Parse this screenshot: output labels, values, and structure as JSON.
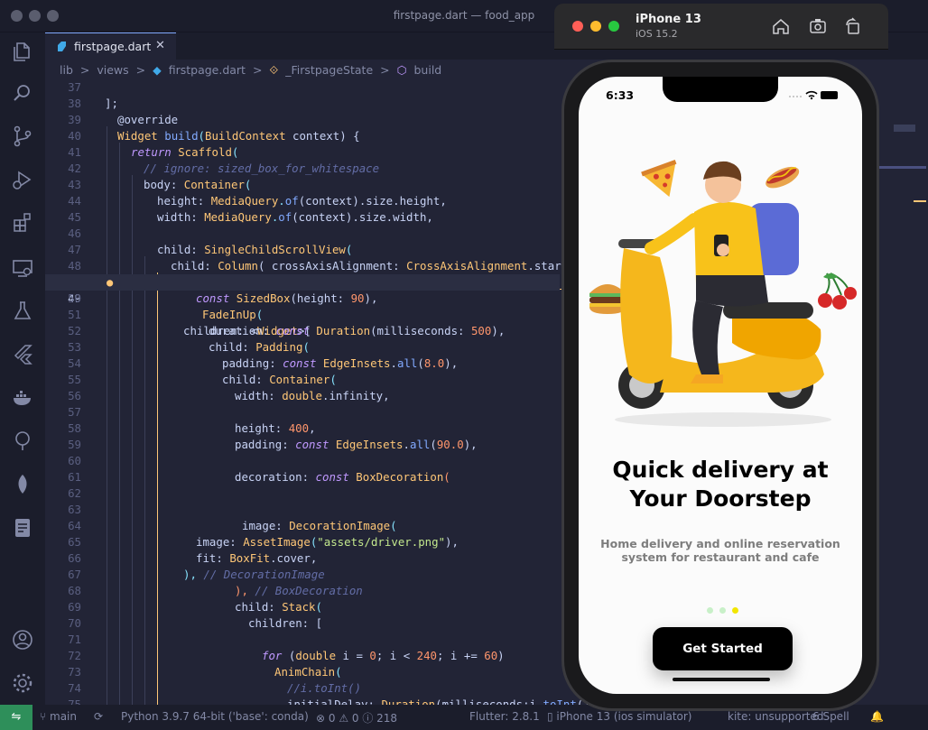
{
  "window": {
    "title": "firstpage.dart — food_app"
  },
  "tab": {
    "label": "firstpage.dart",
    "close": "✕"
  },
  "breadcrumb": {
    "p1": "lib",
    "p2": "views",
    "p3": "firstpage.dart",
    "p4": "_FirstpageState",
    "p5": "build",
    "sep": ">"
  },
  "editor": {
    "lines": [
      {
        "n": "37"
      },
      {
        "n": "38"
      },
      {
        "n": "39"
      },
      {
        "n": "40"
      },
      {
        "n": "41"
      },
      {
        "n": "42"
      },
      {
        "n": "43"
      },
      {
        "n": "44"
      },
      {
        "n": "45"
      },
      {
        "n": "46"
      },
      {
        "n": "47"
      },
      {
        "n": "48"
      },
      {
        "n": "49"
      },
      {
        "n": "50"
      },
      {
        "n": "51"
      },
      {
        "n": "52"
      },
      {
        "n": "53"
      },
      {
        "n": "54"
      },
      {
        "n": "55"
      },
      {
        "n": "56"
      },
      {
        "n": "57"
      },
      {
        "n": "58"
      },
      {
        "n": "59"
      },
      {
        "n": "60"
      },
      {
        "n": "61"
      },
      {
        "n": "62"
      },
      {
        "n": "63"
      },
      {
        "n": "64"
      },
      {
        "n": "65"
      },
      {
        "n": "66"
      },
      {
        "n": "67"
      },
      {
        "n": "68"
      },
      {
        "n": "69"
      },
      {
        "n": "70"
      },
      {
        "n": "71"
      },
      {
        "n": "72"
      },
      {
        "n": "73"
      },
      {
        "n": "74"
      },
      {
        "n": "75"
      }
    ],
    "t38": "];",
    "t39": "@override",
    "t40a": "Widget",
    "t40b": "build",
    "t40c": "(",
    "t40d": "BuildContext",
    "t40e": " context) {",
    "t41a": "return",
    "t41b": " Scaffold",
    "t41c": "(",
    "t42": "// ignore: sized_box_for_whitespace",
    "t43a": "body: ",
    "t43b": "Container",
    "t43c": "(",
    "t44a": "height: ",
    "t44b": "MediaQuery",
    "t44c": ".",
    "t44d": "of",
    "t44e": "(context).size.height,",
    "t45a": "width: ",
    "t45b": "MediaQuery",
    "t45c": ".",
    "t45d": "of",
    "t45e": "(context).size.width,",
    "t47a": "child: ",
    "t47b": "SingleChildScrollView",
    "t47c": "(",
    "t48a": "child: ",
    "t48b": "Column",
    "t48c": "( crossAxisAlignment: ",
    "t48d": "CrossAxisAlignment",
    "t48e": ".start,",
    "t49a": "children: <",
    "t49b": "Widget",
    "t49c": ">[",
    "t50a": "const",
    "t50b": " SizedBox",
    "t50c": "(height: ",
    "t50d": "90",
    "t50e": "),",
    "t51a": "FadeInUp",
    "t51b": "(",
    "t52a": "duration: ",
    "t52b": "const",
    "t52c": " Duration",
    "t52d": "(milliseconds: ",
    "t52e": "500",
    "t52f": "),",
    "t53a": "child: ",
    "t53b": "Padding",
    "t53c": "(",
    "t54a": "padding: ",
    "t54b": "const",
    "t54c": " EdgeInsets",
    "t54d": ".",
    "t54e": "all",
    "t54f": "(",
    "t54g": "8.0",
    "t54h": "),",
    "t55a": "child: ",
    "t55b": "Container",
    "t55c": "(",
    "t56a": "width: ",
    "t56b": "double",
    "t56c": ".infinity,",
    "t58a": "height: ",
    "t58b": "400",
    "t58c": ",",
    "t59a": "padding: ",
    "t59b": "const",
    "t59c": " EdgeInsets",
    "t59d": ".",
    "t59e": "all",
    "t59f": "(",
    "t59g": "90.0",
    "t59h": "),",
    "t61a": "decoration: ",
    "t61b": "const",
    "t61c": " BoxDecoration",
    "t61d": "(",
    "t64a": "image: ",
    "t64b": "DecorationImage",
    "t64c": "(",
    "t65a": "image: ",
    "t65b": "AssetImage",
    "t65c": "(",
    "t65d": "\"assets/driver.png\"",
    "t65e": "),",
    "t66a": "fit: ",
    "t66b": "BoxFit",
    "t66c": ".cover,",
    "t67a": "), ",
    "t67b": "// DecorationImage",
    "t68a": "), ",
    "t68b": "// BoxDecoration",
    "t69a": "child: ",
    "t69b": "Stack",
    "t69c": "(",
    "t70": "children: [",
    "t72a": "for",
    "t72b": " (",
    "t72c": "double",
    "t72d": " i = ",
    "t72e": "0",
    "t72f": "; i < ",
    "t72g": "240",
    "t72h": "; i += ",
    "t72i": "60",
    "t72j": ")",
    "t73a": "AnimChain",
    "t73b": "(",
    "t74": "//i.toInt()",
    "t75a": "initialDelay: ",
    "t75b": "Duration",
    "t75c": "(milliseconds:i.",
    "t75d": "toInt",
    "t75e": "()"
  },
  "statusbar": {
    "branch": "main",
    "python": "Python 3.9.7 64-bit ('base': conda)",
    "problems": "⊗ 0 ⚠ 0 ⓘ 218",
    "flutter": "Flutter: 2.8.1",
    "device": "iPhone 13 (ios simulator)",
    "kite": "kite: unsupported",
    "spell": "6 Spell"
  },
  "simulator": {
    "name": "iPhone 13",
    "os": "iOS 15.2"
  },
  "phone": {
    "time": "6:33",
    "title_line1": "Quick delivery at",
    "title_line2": "Your Doorstep",
    "subtitle_line1": "Home delivery and online reservation",
    "subtitle_line2": "system for restaurant and cafe",
    "cta": "Get Started",
    "page_indicator": {
      "count": 3,
      "active_index": 2
    }
  },
  "colors": {
    "accent": "#82aaff",
    "dot_inactive": "#c8f0c8",
    "dot_active": "#f2e600",
    "status_remote": "#2e8f5a"
  }
}
